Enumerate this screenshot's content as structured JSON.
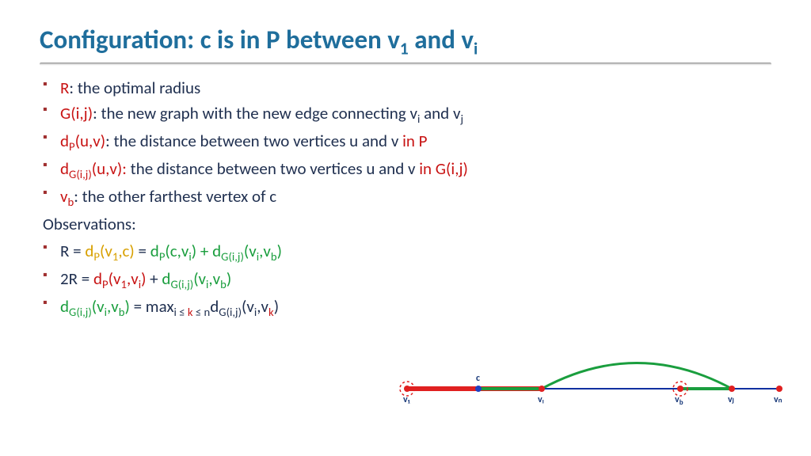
{
  "title_parts": {
    "pre": "Configuration: c is in P between v",
    "sub1": "1",
    "mid": " and v",
    "sub2": "i"
  },
  "bullets": [
    {
      "term": "R",
      "term_class": "term-r",
      "rest": ": the optimal radius"
    },
    {
      "term": "G(i,j)",
      "term_class": "term-r",
      "rest_pre": ": the new graph with the new edge connecting v",
      "sub1": "i",
      "rest_mid": " and v",
      "sub2": "j"
    },
    {
      "term_pre": "d",
      "sub": "P",
      "term_post": "(u,v)",
      "term_class": "term-r",
      "rest": ": the distance between two vertices u and v ",
      "suffix": "in P",
      "suffix_class": "term-r"
    },
    {
      "term_pre": "d",
      "sub": "G(i,j)",
      "term_post": "(u,v):",
      "term_class": "term-r",
      "rest": " the distance between two vertices u and v ",
      "suffix": "in G(i,j)",
      "suffix_class": "term-r"
    },
    {
      "term_pre": "v",
      "sub": "b",
      "term_class": "term-r",
      "rest": ": the other farthest vertex of c"
    }
  ],
  "observations_label": "Observations:",
  "eqs": {
    "eq1": {
      "lhs": "R = ",
      "p1": "d",
      "p1sub": "P",
      "p1arg_pre": "(v",
      "p1arg_sub": "1",
      "p1arg_post": ",c)",
      "eq": " = ",
      "p2": "d",
      "p2sub": "P",
      "p2arg_pre": "(c,v",
      "p2arg_sub": "i",
      "p2arg_post": ")",
      "plus": " + ",
      "p3": "d",
      "p3sub": "G(i,j)",
      "p3arg_pre": "(v",
      "p3arg_sub1": "i",
      "p3arg_mid": ",v",
      "p3arg_sub2": "b",
      "p3arg_post": ")"
    },
    "eq2": {
      "lhs": "2R = ",
      "p1": "d",
      "p1sub": "P",
      "p1arg_pre": "(v",
      "p1arg_sub1": "1",
      "p1arg_mid": ",v",
      "p1arg_sub2": "i",
      "p1arg_post": ")",
      "plus": " + ",
      "p2": "d",
      "p2sub": "G(i,j)",
      "p2arg_pre": "(v",
      "p2arg_sub1": "i",
      "p2arg_mid": ",v",
      "p2arg_sub2": "b",
      "p2arg_post": ")"
    },
    "eq3": {
      "lhs_pre": "d",
      "lhs_sub": "G(i,j)",
      "lhs_arg_pre": "(v",
      "lhs_arg_sub1": "i",
      "lhs_arg_mid": ",v",
      "lhs_arg_sub2": "b",
      "lhs_arg_post": ")",
      "eq": " = max",
      "cond_pre": "i ≤ ",
      "cond_k": "k",
      "cond_post": " ≤ n",
      "rhs_pre": "d",
      "rhs_sub": "G(i,j)",
      "rhs_arg_pre": "(v",
      "rhs_arg_sub1": "i",
      "rhs_arg_mid": ",v",
      "rhs_arg_sub2": "k",
      "rhs_arg_post": ")"
    }
  },
  "diagram": {
    "labels": {
      "v1": "v₁",
      "c": "c",
      "vi": "vᵢ",
      "vb": "v_b",
      "vj": "vⱼ",
      "vn": "vₙ"
    },
    "colors": {
      "blue": "#1030a0",
      "red": "#e02020",
      "green": "#1a9e3e",
      "dot_blue": "#2040c0"
    }
  }
}
